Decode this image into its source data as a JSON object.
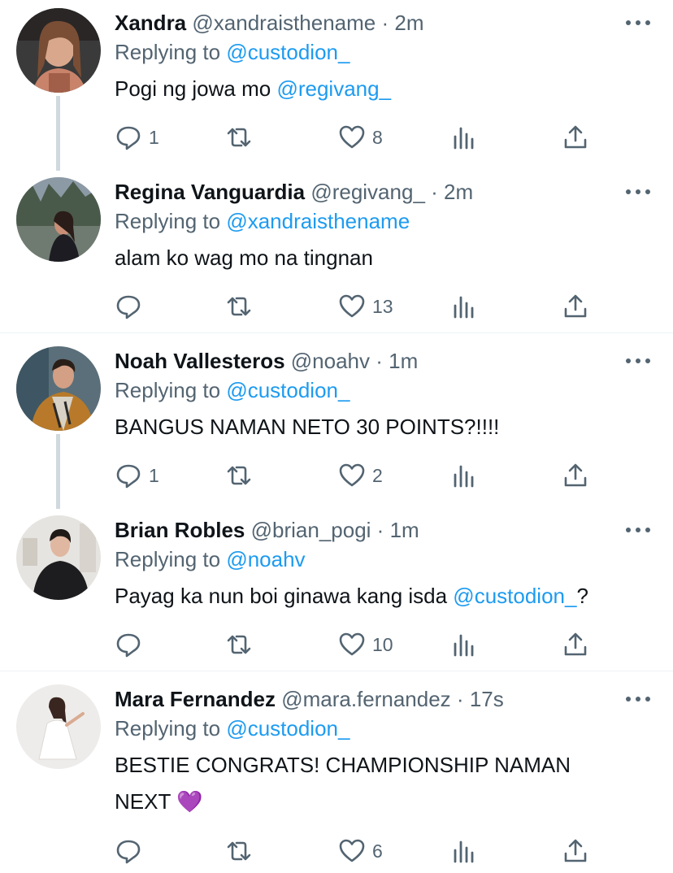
{
  "colors": {
    "accent": "#1d9bf0",
    "muted": "#536471",
    "text": "#0f1419",
    "heart_emoji": "#9b59d0"
  },
  "tweets": [
    {
      "name": "Xandra",
      "handle": "@xandraisthename",
      "sep": "·",
      "time": "2m",
      "reply_prefix": "Replying to",
      "reply_to": "@custodion_",
      "text": "Pogi ng jowa mo ",
      "mention": "@regivang_",
      "text_after": "",
      "counts": {
        "reply": "1",
        "retweet": "",
        "like": "8"
      }
    },
    {
      "name": "Regina Vanguardia",
      "handle": "@regivang_",
      "sep": "·",
      "time": "2m",
      "reply_prefix": "Replying to",
      "reply_to": "@xandraisthename",
      "text": "alam ko wag mo na tingnan",
      "mention": "",
      "text_after": "",
      "counts": {
        "reply": "",
        "retweet": "",
        "like": "13"
      }
    },
    {
      "name": "Noah Vallesteros",
      "handle": "@noahv",
      "sep": "·",
      "time": "1m",
      "reply_prefix": "Replying to",
      "reply_to": "@custodion_",
      "text": "BANGUS NAMAN NETO 30 POINTS?!!!!",
      "mention": "",
      "text_after": "",
      "counts": {
        "reply": "1",
        "retweet": "",
        "like": "2"
      }
    },
    {
      "name": "Brian Robles",
      "handle": "@brian_pogi",
      "sep": "·",
      "time": "1m",
      "reply_prefix": "Replying to",
      "reply_to": "@noahv",
      "text": "Payag ka nun boi ginawa kang isda ",
      "mention": "@custodion_",
      "text_after": "?",
      "counts": {
        "reply": "",
        "retweet": "",
        "like": "10"
      }
    },
    {
      "name": "Mara Fernandez",
      "handle": "@mara.fernandez",
      "sep": "·",
      "time": "17s",
      "reply_prefix": "Replying to",
      "reply_to": "@custodion_",
      "text": "BESTIE CONGRATS! CHAMPIONSHIP NAMAN",
      "text_line2": "NEXT ",
      "emoji": "💜",
      "counts": {
        "reply": "",
        "retweet": "",
        "like": "6"
      }
    }
  ]
}
